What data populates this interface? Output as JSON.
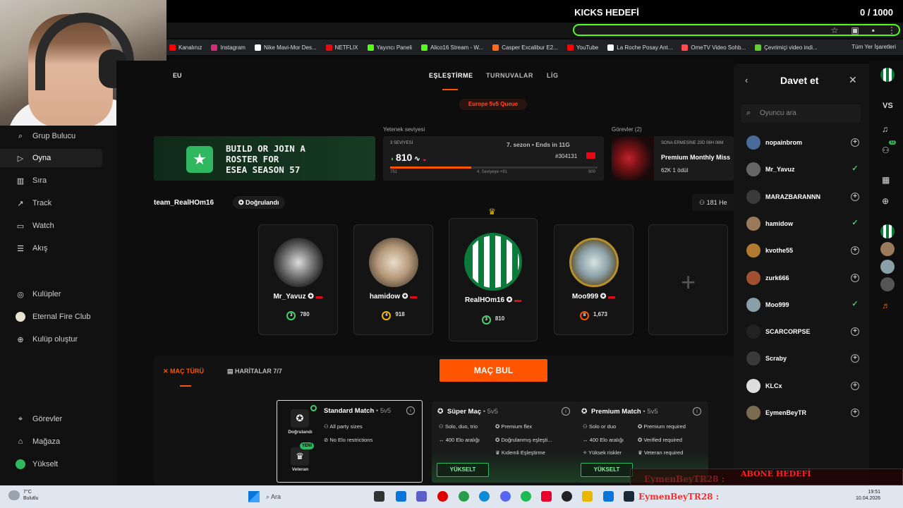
{
  "stream": {
    "goal_title": "KICKS HEDEFİ",
    "goal_count": "0 / 1000",
    "sub_goal": "ABONE HEDEFİ",
    "sub_name": "EymenBeyTR28 :"
  },
  "bookmarks": [
    {
      "label": "Kanalınız",
      "color": "#ff0000"
    },
    {
      "label": "Instagram",
      "color": "#d62976"
    },
    {
      "label": "Nike Mavi-Mor Des...",
      "color": "#ffffff"
    },
    {
      "label": "NETFLIX",
      "color": "#e50914"
    },
    {
      "label": "Yayıncı Paneli",
      "color": "#53fc18"
    },
    {
      "label": "Alico16 Stream - W...",
      "color": "#53fc18"
    },
    {
      "label": "Casper Excalibur E2...",
      "color": "#f36c21"
    },
    {
      "label": "YouTube",
      "color": "#ff0000"
    },
    {
      "label": "La Roche Posay Ant...",
      "color": "#ffffff"
    },
    {
      "label": "OmeTV Video Sohb...",
      "color": "#ff4d4d"
    },
    {
      "label": "Çevrimiçi video indi...",
      "color": "#66cc33"
    }
  ],
  "bookmarks_all": "Tüm Yer İşaretleri",
  "sidebar": {
    "items": [
      {
        "label": "Grup Bulucu",
        "icon": "search-icon"
      },
      {
        "label": "Oyna",
        "icon": "play-icon"
      },
      {
        "label": "Sıra",
        "icon": "rank-icon"
      },
      {
        "label": "Track",
        "icon": "chart-icon"
      },
      {
        "label": "Watch",
        "icon": "video-icon"
      },
      {
        "label": "Akış",
        "icon": "feed-icon"
      }
    ],
    "clubs": [
      {
        "label": "Kulüpler",
        "icon": "globe-icon"
      },
      {
        "label": "Eternal Fire Club",
        "icon": "club-avatar"
      },
      {
        "label": "Kulüp oluştur",
        "icon": "plus-circle-icon"
      }
    ],
    "bottom": [
      {
        "label": "Görevler",
        "icon": "target-icon"
      },
      {
        "label": "Mağaza",
        "icon": "shop-icon"
      },
      {
        "label": "Yükselt",
        "icon": "upgrade-icon"
      }
    ]
  },
  "header": {
    "region": "EU",
    "tabs": [
      "EŞLEŞTİRME",
      "TURNUVALAR",
      "LİG"
    ],
    "queue": "Europe 5v5 Queue"
  },
  "banner": {
    "line1": "BUILD OR JOIN A",
    "line2": "ROSTER FOR",
    "line3": "ESEA SEASON 57"
  },
  "skill": {
    "label": "Yetenek seviyesi",
    "level_text": "3 SEVİYESİ",
    "season": "7. sezon • Ends in 11G",
    "elo": "810",
    "rank": "#304131",
    "min": "751",
    "next": "4. Seviyeye +91",
    "max": "900",
    "progress": 0.39
  },
  "missions": {
    "label": "Görevler (2)",
    "sub": "SONA ERMESİNE 20D 06H 08M",
    "title": "Premium Monthly Miss",
    "stats": "62K   1 ödül"
  },
  "team": {
    "name": "team_RealHOm16",
    "verified": "Doğrulandı",
    "count": "181  He"
  },
  "players": [
    {
      "name": "Mr_Yavuz",
      "level": "3",
      "elo": "780",
      "lvl_class": "",
      "color": "#555"
    },
    {
      "name": "hamidow",
      "level": "4",
      "elo": "918",
      "lvl_class": "y",
      "color": "#9a7a5a"
    },
    {
      "name": "RealHOm16",
      "level": "3",
      "elo": "810",
      "lvl_class": "",
      "color": "#0b7a3a"
    },
    {
      "name": "Moo999",
      "level": "8",
      "elo": "1,673",
      "lvl_class": "o",
      "color": "#8aa0a8"
    }
  ],
  "match": {
    "tab_type": "MAÇ TÜRÜ",
    "tab_maps": "HARİTALAR 7/7",
    "find_button": "MAÇ BUL",
    "verified_badge": "Doğrulandı",
    "veteran_badge": "Veteran",
    "new_badge": "YENİ",
    "cards": [
      {
        "title": "Standard Match",
        "mode": "• 5v5",
        "features": [
          "All party sizes",
          "No Elo restrictions"
        ]
      },
      {
        "title": "Süper Maç",
        "mode": "• 5v5",
        "features": [
          "Solo, duo, trio",
          "Premium flex",
          "400 Elo aralığı",
          "Doğrulanmış eşleşti...",
          "Kıdemli Eşleştirme"
        ],
        "button": "YÜKSELT"
      },
      {
        "title": "Premium Match",
        "mode": "• 5v5",
        "features": [
          "Solo or duo",
          "Premium required",
          "400 Elo aralığı",
          "Verified required",
          "Yüksek riskler",
          "Veteran required"
        ],
        "button": "YÜKSELT"
      }
    ]
  },
  "invite": {
    "title": "Davet et",
    "search_placeholder": "Oyuncu ara",
    "users": [
      {
        "name": "nopainbrom",
        "invited": false,
        "color": "#4a6a9a"
      },
      {
        "name": "Mr_Yavuz",
        "invited": true,
        "color": "#666"
      },
      {
        "name": "MARAZBARANNN",
        "invited": false,
        "color": "#3a3a3a"
      },
      {
        "name": "hamidow",
        "invited": true,
        "color": "#9a7a5a"
      },
      {
        "name": "kvothe55",
        "invited": false,
        "color": "#b07a30"
      },
      {
        "name": "zurk666",
        "invited": false,
        "color": "#a05030"
      },
      {
        "name": "Moo999",
        "invited": true,
        "color": "#8aa0a8"
      },
      {
        "name": "SCARCORPSE",
        "invited": false,
        "color": "#222"
      },
      {
        "name": "Scraby",
        "invited": false,
        "color": "#3a3a3a"
      },
      {
        "name": "KLCx",
        "invited": false,
        "color": "#ddd"
      },
      {
        "name": "EymenBeyTR",
        "invited": false,
        "color": "#7a6a50"
      }
    ]
  },
  "strip": {
    "vs": "VS",
    "badge": "11"
  },
  "taskbar": {
    "temp": "7°C",
    "weather": "Bulutlu",
    "search": "Ara",
    "time": "19:51",
    "date": "10.04.2026"
  }
}
